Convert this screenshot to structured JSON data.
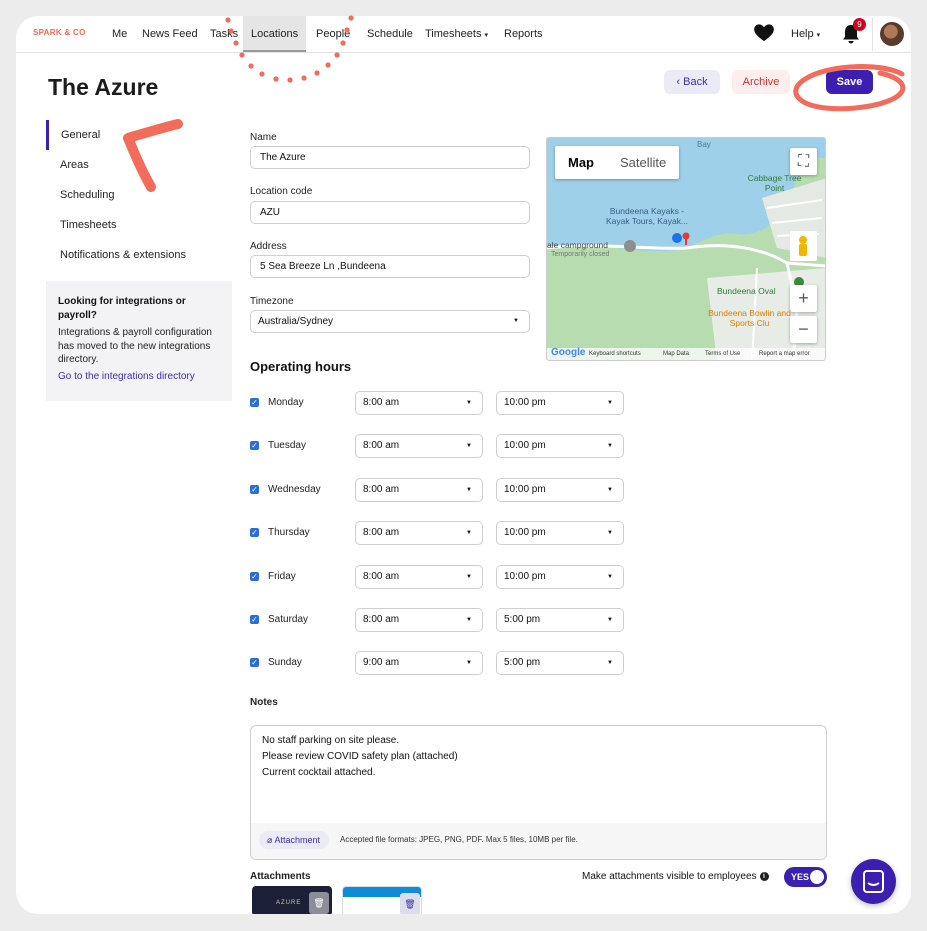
{
  "brand": "SPARK & CO",
  "nav": {
    "me": "Me",
    "news_feed": "News Feed",
    "tasks": "Tasks",
    "locations": "Locations",
    "people": "People",
    "schedule": "Schedule",
    "timesheets": "Timesheets",
    "reports": "Reports",
    "help": "Help",
    "notification_count": "9",
    "caret": "▾"
  },
  "page": {
    "title": "The Azure"
  },
  "actions": {
    "back": "Back",
    "archive": "Archive",
    "save": "Save"
  },
  "sidebar": {
    "items": [
      {
        "label": "General"
      },
      {
        "label": "Areas"
      },
      {
        "label": "Scheduling"
      },
      {
        "label": "Timesheets"
      },
      {
        "label": "Notifications & extensions"
      }
    ],
    "card": {
      "heading": "Looking for integrations or payroll?",
      "body": "Integrations & payroll configuration has moved to the new integrations directory.",
      "link": "Go to the integrations directory"
    }
  },
  "form": {
    "name_label": "Name",
    "name_value": "The Azure",
    "code_label": "Location code",
    "code_value": "AZU",
    "address_label": "Address",
    "address_value": "5 Sea Breeze Ln ,Bundeena",
    "timezone_label": "Timezone",
    "timezone_value": "Australia/Sydney"
  },
  "map": {
    "tab_map": "Map",
    "tab_satellite": "Satellite",
    "labels": {
      "cabbage": "Cabbage Tree Point",
      "kayaks": "Bundeena Kayaks - Kayak Tours, Kayak...",
      "campground": "ale campground",
      "closed": "Temporarily closed",
      "oval": "Bundeena Oval",
      "bowling": "Bundeena Bowlin and Sports Clu",
      "bay": "Bay"
    },
    "footer": {
      "google": "Google",
      "shortcuts": "Keyboard shortcuts",
      "map_data": "Map Data",
      "terms": "Terms of Use",
      "report": "Report a map error"
    }
  },
  "hours": {
    "heading": "Operating hours",
    "days": [
      {
        "day": "Monday",
        "open": "8:00 am",
        "close": "10:00 pm"
      },
      {
        "day": "Tuesday",
        "open": "8:00 am",
        "close": "10:00 pm"
      },
      {
        "day": "Wednesday",
        "open": "8:00 am",
        "close": "10:00 pm"
      },
      {
        "day": "Thursday",
        "open": "8:00 am",
        "close": "10:00 pm"
      },
      {
        "day": "Friday",
        "open": "8:00 am",
        "close": "10:00 pm"
      },
      {
        "day": "Saturday",
        "open": "8:00 am",
        "close": "5:00 pm"
      },
      {
        "day": "Sunday",
        "open": "9:00 am",
        "close": "5:00 pm"
      }
    ]
  },
  "notes": {
    "label": "Notes",
    "line1": "No staff parking on site please.",
    "line2": "Please review COVID safety plan (attached)",
    "line3": "Current cocktail attached.",
    "attachment_button": "Attachment",
    "accepted": "Accepted file formats: JPEG, PNG, PDF. Max 5 files, 10MB per file."
  },
  "attachments": {
    "label": "Attachments",
    "visible_label": "Make attachments visible to employees",
    "toggle": "YES",
    "thumb1_text": "AZURE"
  },
  "colors": {
    "accent": "#3a1fb0",
    "brand": "#f06a55",
    "annotation": "#f26b5b",
    "danger": "#cc3333"
  }
}
